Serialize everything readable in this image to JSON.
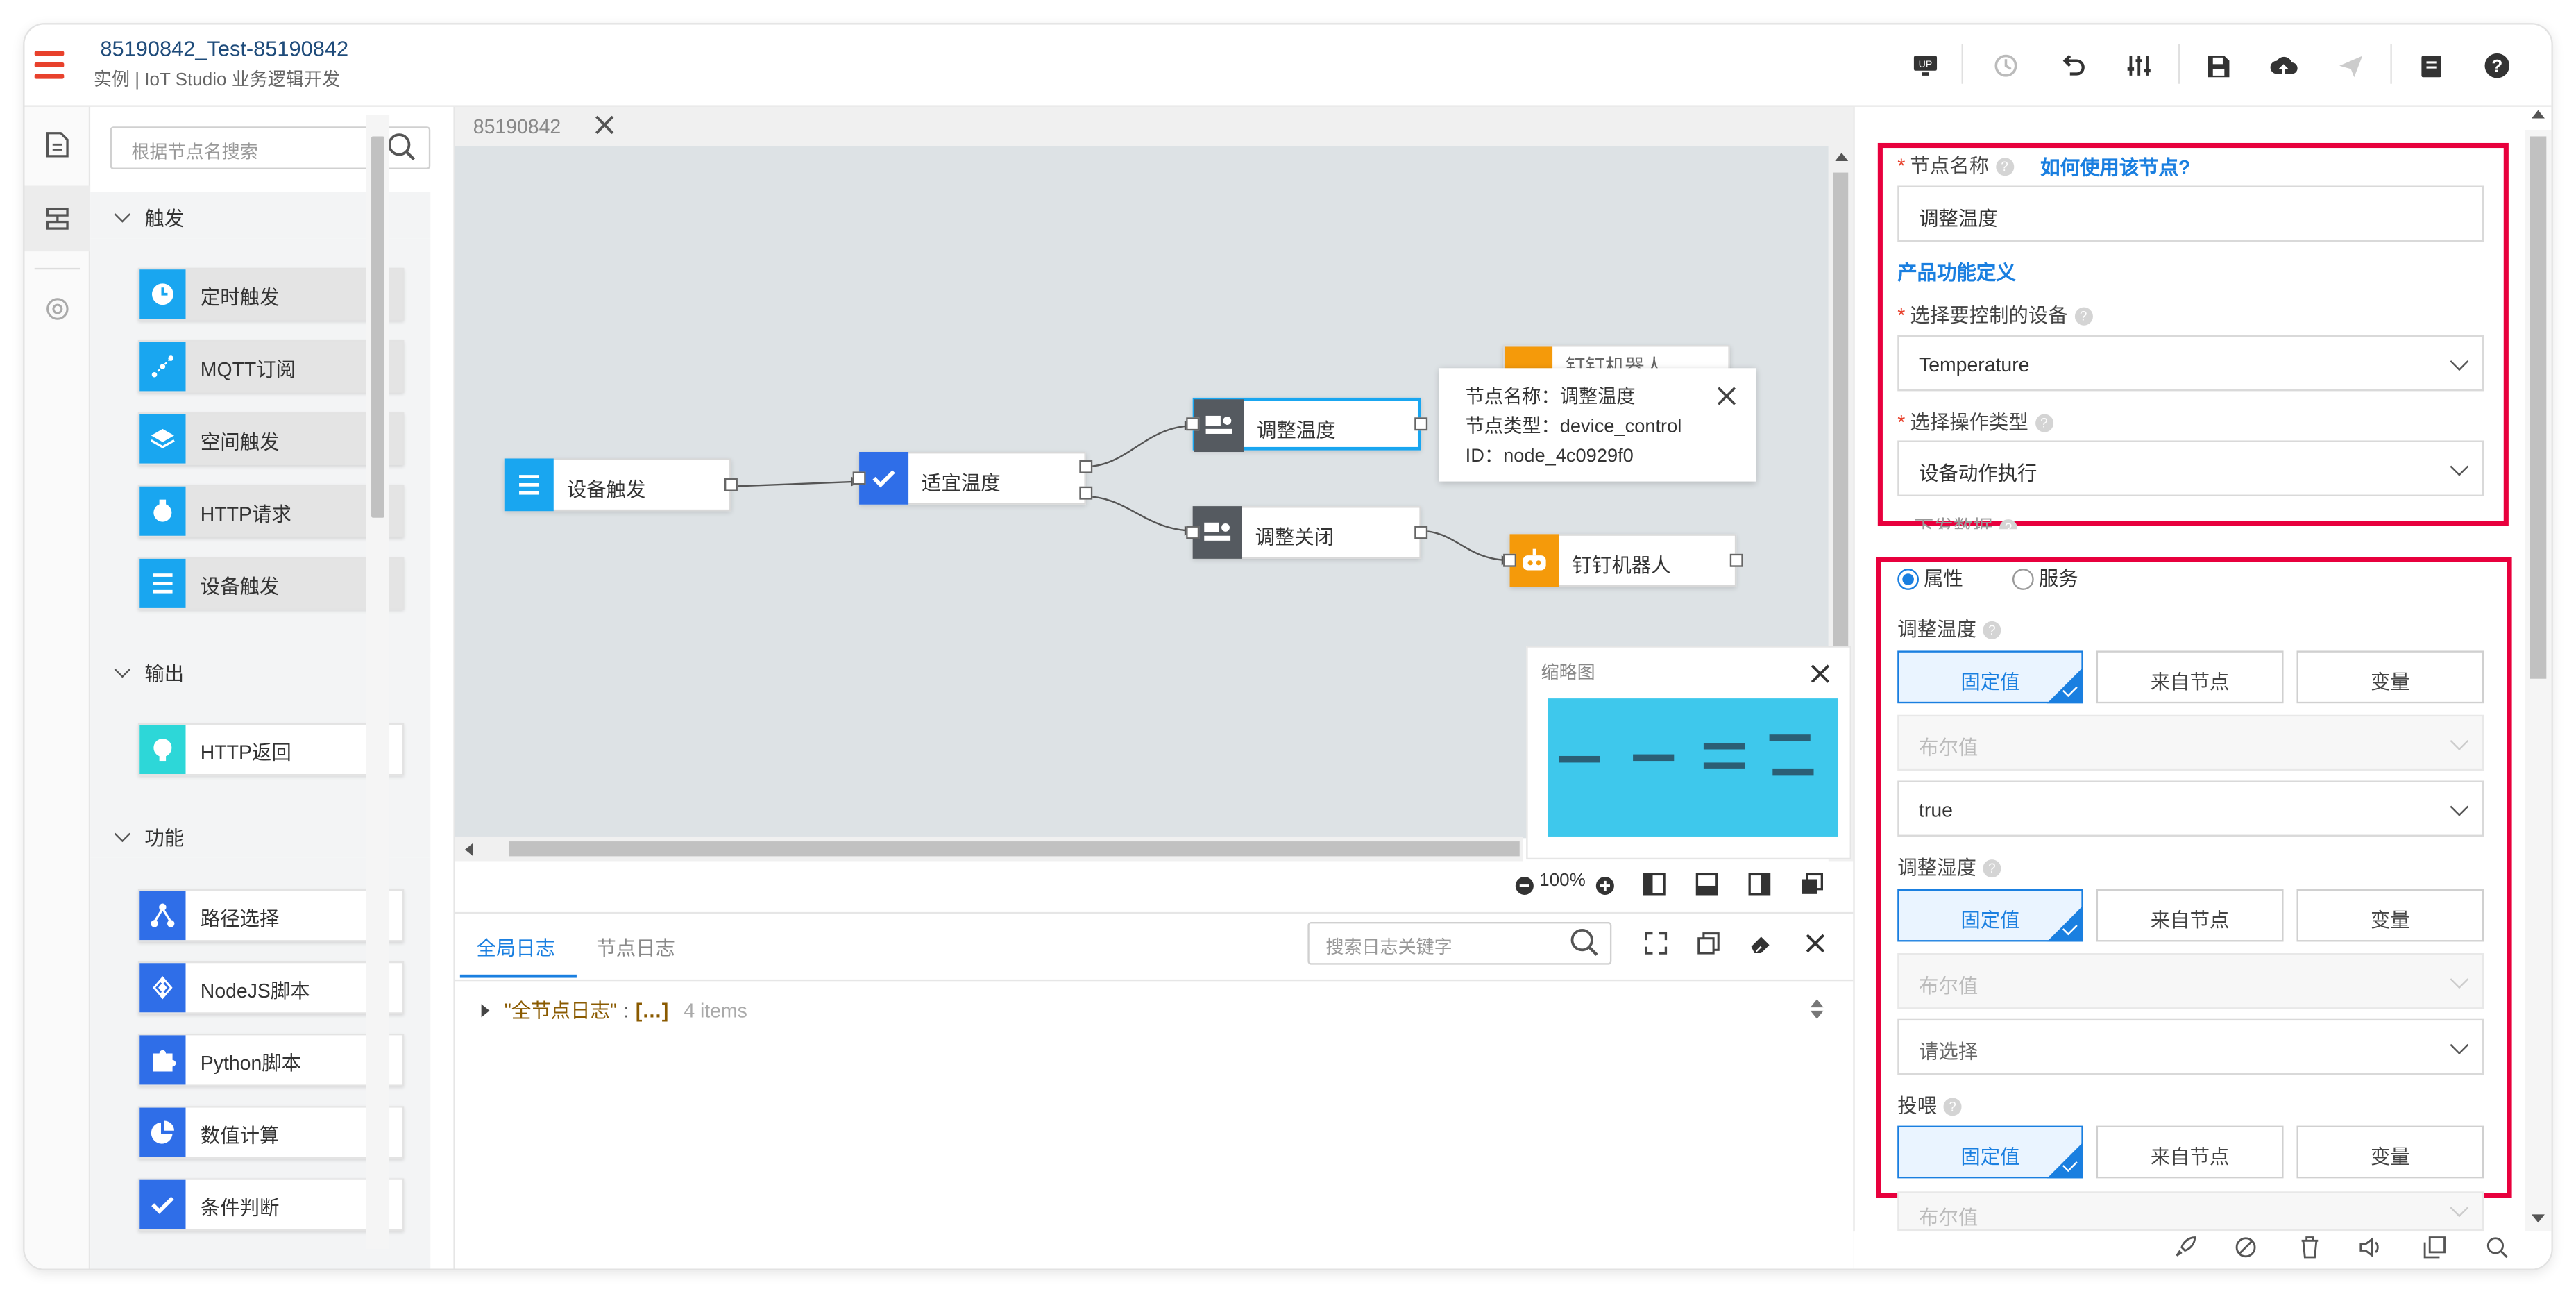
{
  "header": {
    "project_title": "85190842_Test-85190842",
    "breadcrumb": "实例 | IoT Studio 业务逻辑开发"
  },
  "palette": {
    "search_placeholder": "根据节点名搜索",
    "sections": [
      {
        "title": "触发",
        "items": [
          "定时触发",
          "MQTT订阅",
          "空间触发",
          "HTTP请求",
          "设备触发"
        ]
      },
      {
        "title": "输出",
        "items": [
          "HTTP返回"
        ]
      },
      {
        "title": "功能",
        "items": [
          "路径选择",
          "NodeJS脚本",
          "Python脚本",
          "数值计算",
          "条件判断"
        ]
      }
    ]
  },
  "canvas": {
    "tab_label": "85190842",
    "nodes": {
      "device_trigger": "设备触发",
      "temp_check": "适宜温度",
      "adjust_temp": "调整温度",
      "adjust_close": "调整关闭",
      "dingtalk_bottom": "钉钉机器人",
      "dingtalk_top": "钉钉机器人"
    },
    "tooltip": {
      "name_line": "节点名称：调整温度",
      "type_line": "节点类型：device_control",
      "id_line": "ID：node_4c0929f0"
    },
    "minimap_title": "缩略图",
    "zoom": "100%"
  },
  "log": {
    "tabs": [
      "全局日志",
      "节点日志"
    ],
    "search_placeholder": "搜索日志关键字",
    "entry_key": "\"全节点日志\"",
    "entry_colon": ":",
    "entry_value": "[…]",
    "entry_count": "4 items"
  },
  "config": {
    "node_name_label": "节点名称",
    "how_to_link": "如何使用该节点?",
    "node_name_value": "调整温度",
    "product_def": "产品功能定义",
    "device_label": "选择要控制的设备",
    "device_value": "Temperature",
    "op_type_label": "选择操作类型",
    "op_type_value": "设备动作执行",
    "send_data_label": "下发数据",
    "radio_property": "属性",
    "radio_service": "服务",
    "segments": [
      "固定值",
      "来自节点",
      "变量"
    ],
    "bool_placeholder": "布尔值",
    "params": [
      {
        "label": "调整温度",
        "value": "true"
      },
      {
        "label": "调整湿度",
        "value": "请选择"
      },
      {
        "label": "投喂",
        "value": ""
      }
    ]
  },
  "colors": {
    "accent": "#1a7fe0",
    "highlight_box": "#e8003d",
    "node_blue": "#19a6f0",
    "node_dark": "#555a60",
    "node_orange": "#f59a0a",
    "canvas_bg": "#dde2e5"
  }
}
